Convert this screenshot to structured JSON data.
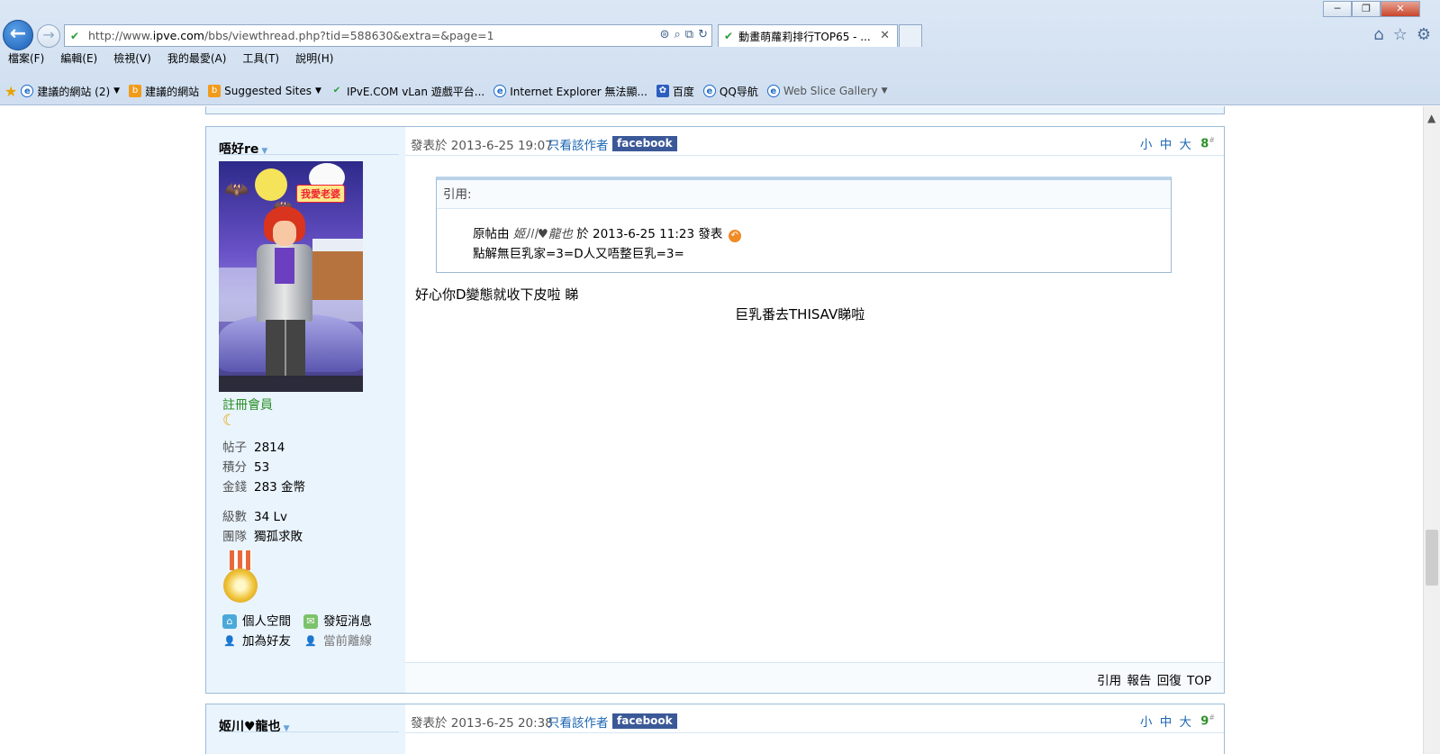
{
  "browser": {
    "url_prefix": "http://www.",
    "url_domain": "ipve.com",
    "url_rest": "/bbs/viewthread.php?tid=588630&extra=&page=1",
    "tab_title": "動畫萌蘿莉排行TOP65 - ...",
    "menu": [
      "檔案(F)",
      "編輯(E)",
      "檢視(V)",
      "我的最愛(A)",
      "工具(T)",
      "說明(H)"
    ],
    "favorites": [
      {
        "label": "建議的網站 (2)",
        "icon": "ie-icon",
        "dropdown": true
      },
      {
        "label": "建議的網站",
        "icon": "suggested-sites-icon",
        "dropdown": false
      },
      {
        "label": "Suggested Sites",
        "icon": "suggested-sites-icon",
        "dropdown": true
      },
      {
        "label": "IPvE.COM vLan 遊戲平台...",
        "icon": "ipve-icon",
        "dropdown": false
      },
      {
        "label": "Internet Explorer 無法顯...",
        "icon": "ie-icon",
        "dropdown": false
      },
      {
        "label": "百度",
        "icon": "baidu-paw-icon",
        "dropdown": false
      },
      {
        "label": "QQ导航",
        "icon": "ie-icon",
        "dropdown": false
      },
      {
        "label": "Web Slice Gallery",
        "icon": "web-slice-icon",
        "dropdown": true
      }
    ]
  },
  "post1": {
    "username": "唔好re",
    "avatar_tag": "我愛老婆",
    "rank": "註冊會員",
    "stats": [
      {
        "label": "帖子",
        "value": "2814"
      },
      {
        "label": "積分",
        "value": "53"
      },
      {
        "label": "金錢",
        "value": "283 金幣"
      }
    ],
    "stats2": [
      {
        "label": "級數",
        "value": "34 Lv"
      },
      {
        "label": "團隊",
        "value": "獨孤求敗"
      }
    ],
    "links": {
      "space": "個人空間",
      "pm": "發短消息",
      "add_friend": "加為好友",
      "status": "當前離線"
    },
    "posted_at": "發表於 2013-6-25 19:07",
    "only_author": "只看該作者",
    "facebook": "facebook",
    "font_sizes": "小 中 大",
    "floor": "8",
    "quote": {
      "header": "引用:",
      "src_prefix": "原帖由",
      "src_author": "姬川♥龍也",
      "src_suffix": "於 2013-6-25 11:23 發表",
      "text": "點解無巨乳家=3=D人又唔整巨乳=3="
    },
    "body_line1": "好心你D變態就收下皮啦 睇",
    "body_line2": "巨乳番去THISAV睇啦",
    "actions": "引用 報告 回復 TOP"
  },
  "post2": {
    "username": "姬川♥龍也",
    "posted_at": "發表於 2013-6-25 20:38",
    "only_author": "只看該作者",
    "facebook": "facebook",
    "font_sizes": "小 中 大",
    "floor": "9"
  },
  "colors": {
    "link": "#1c67b3",
    "rank_green": "#2b9128",
    "facebook_blue": "#3b5998",
    "sidebar_bg": "#eaf4fd",
    "border": "#9dbbd6"
  }
}
